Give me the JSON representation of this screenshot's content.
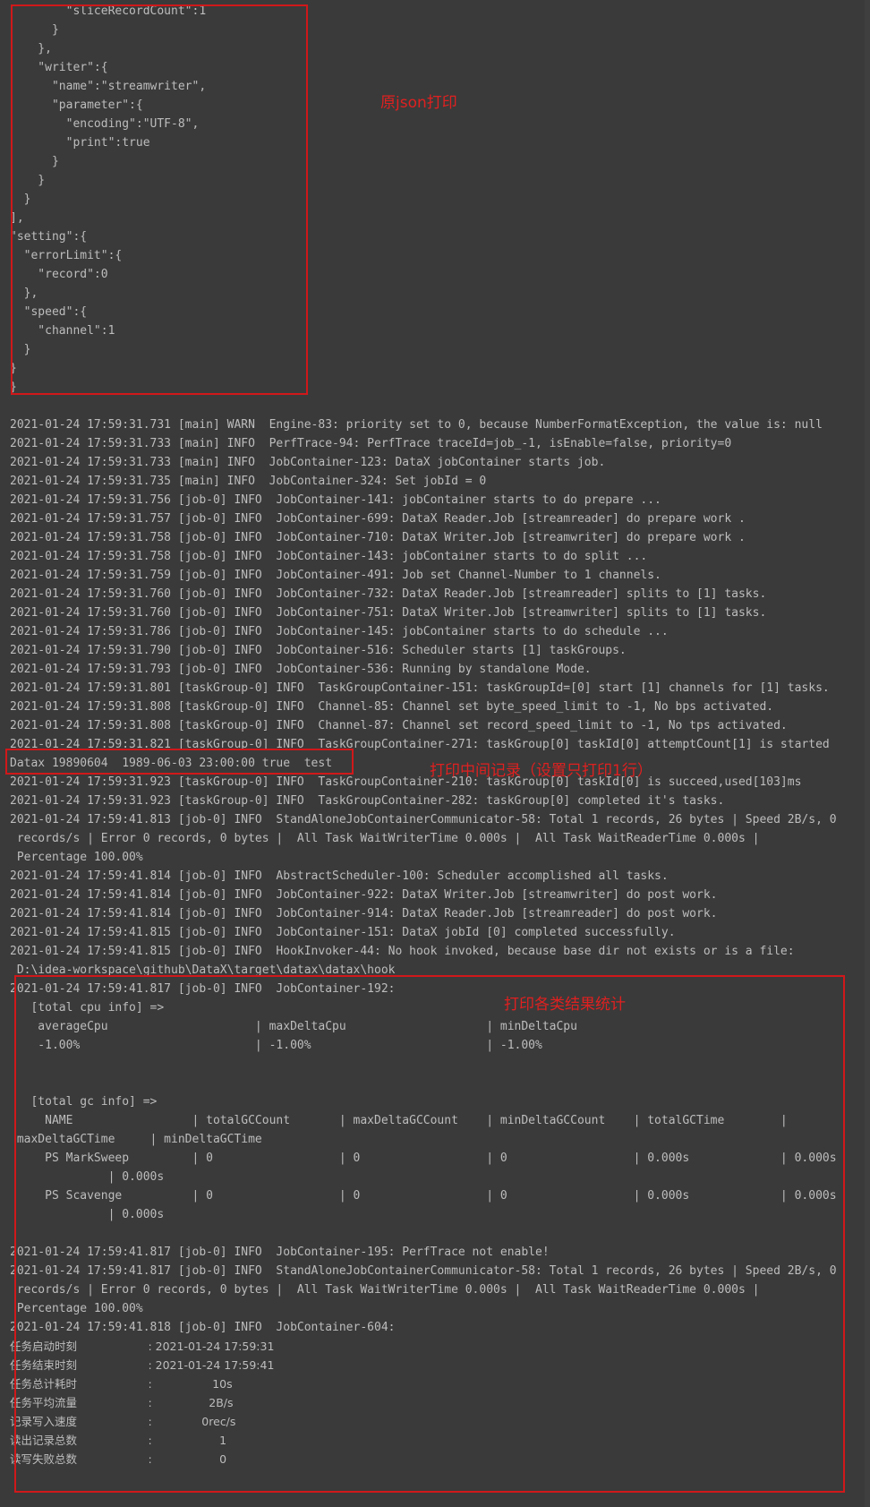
{
  "annotations": {
    "json_note": "原json打印",
    "record_note": "打印中间记录（设置只打印1行）",
    "stats_note": "打印各类结果统计"
  },
  "lines": [
    "        \"sliceRecordCount\":1",
    "      }",
    "    },",
    "    \"writer\":{",
    "      \"name\":\"streamwriter\",",
    "      \"parameter\":{",
    "        \"encoding\":\"UTF-8\",",
    "        \"print\":true",
    "      }",
    "    }",
    "  }",
    "],",
    "\"setting\":{",
    "  \"errorLimit\":{",
    "    \"record\":0",
    "  },",
    "  \"speed\":{",
    "    \"channel\":1",
    "  }",
    "}",
    "}",
    "",
    "2021-01-24 17:59:31.731 [main] WARN  Engine-83: priority set to 0, because NumberFormatException, the value is: null",
    "2021-01-24 17:59:31.733 [main] INFO  PerfTrace-94: PerfTrace traceId=job_-1, isEnable=false, priority=0",
    "2021-01-24 17:59:31.733 [main] INFO  JobContainer-123: DataX jobContainer starts job.",
    "2021-01-24 17:59:31.735 [main] INFO  JobContainer-324: Set jobId = 0",
    "2021-01-24 17:59:31.756 [job-0] INFO  JobContainer-141: jobContainer starts to do prepare ...",
    "2021-01-24 17:59:31.757 [job-0] INFO  JobContainer-699: DataX Reader.Job [streamreader] do prepare work .",
    "2021-01-24 17:59:31.758 [job-0] INFO  JobContainer-710: DataX Writer.Job [streamwriter] do prepare work .",
    "2021-01-24 17:59:31.758 [job-0] INFO  JobContainer-143: jobContainer starts to do split ...",
    "2021-01-24 17:59:31.759 [job-0] INFO  JobContainer-491: Job set Channel-Number to 1 channels.",
    "2021-01-24 17:59:31.760 [job-0] INFO  JobContainer-732: DataX Reader.Job [streamreader] splits to [1] tasks.",
    "2021-01-24 17:59:31.760 [job-0] INFO  JobContainer-751: DataX Writer.Job [streamwriter] splits to [1] tasks.",
    "2021-01-24 17:59:31.786 [job-0] INFO  JobContainer-145: jobContainer starts to do schedule ...",
    "2021-01-24 17:59:31.790 [job-0] INFO  JobContainer-516: Scheduler starts [1] taskGroups.",
    "2021-01-24 17:59:31.793 [job-0] INFO  JobContainer-536: Running by standalone Mode.",
    "2021-01-24 17:59:31.801 [taskGroup-0] INFO  TaskGroupContainer-151: taskGroupId=[0] start [1] channels for [1] tasks.",
    "2021-01-24 17:59:31.808 [taskGroup-0] INFO  Channel-85: Channel set byte_speed_limit to -1, No bps activated.",
    "2021-01-24 17:59:31.808 [taskGroup-0] INFO  Channel-87: Channel set record_speed_limit to -1, No tps activated.",
    "2021-01-24 17:59:31.821 [taskGroup-0] INFO  TaskGroupContainer-271: taskGroup[0] taskId[0] attemptCount[1] is started",
    "Datax 19890604  1989-06-03 23:00:00 true  test",
    "2021-01-24 17:59:31.923 [taskGroup-0] INFO  TaskGroupContainer-210: taskGroup[0] taskId[0] is succeed,used[103]ms",
    "2021-01-24 17:59:31.923 [taskGroup-0] INFO  TaskGroupContainer-282: taskGroup[0] completed it's tasks.",
    "2021-01-24 17:59:41.813 [job-0] INFO  StandAloneJobContainerCommunicator-58: Total 1 records, 26 bytes | Speed 2B/s, 0",
    " records/s | Error 0 records, 0 bytes |  All Task WaitWriterTime 0.000s |  All Task WaitReaderTime 0.000s |",
    " Percentage 100.00%",
    "2021-01-24 17:59:41.814 [job-0] INFO  AbstractScheduler-100: Scheduler accomplished all tasks.",
    "2021-01-24 17:59:41.814 [job-0] INFO  JobContainer-922: DataX Writer.Job [streamwriter] do post work.",
    "2021-01-24 17:59:41.814 [job-0] INFO  JobContainer-914: DataX Reader.Job [streamreader] do post work.",
    "2021-01-24 17:59:41.815 [job-0] INFO  JobContainer-151: DataX jobId [0] completed successfully.",
    "2021-01-24 17:59:41.815 [job-0] INFO  HookInvoker-44: No hook invoked, because base dir not exists or is a file:",
    " D:\\idea-workspace\\github\\DataX\\target\\datax\\datax\\hook",
    "2021-01-24 17:59:41.817 [job-0] INFO  JobContainer-192:",
    "   [total cpu info] =>",
    "    averageCpu                     | maxDeltaCpu                    | minDeltaCpu",
    "    -1.00%                         | -1.00%                         | -1.00%",
    "",
    "",
    "   [total gc info] =>",
    "     NAME                 | totalGCCount       | maxDeltaGCCount    | minDeltaGCCount    | totalGCTime        |",
    " maxDeltaGCTime     | minDeltaGCTime",
    "     PS MarkSweep         | 0                  | 0                  | 0                  | 0.000s             | 0.000s",
    "              | 0.000s",
    "     PS Scavenge          | 0                  | 0                  | 0                  | 0.000s             | 0.000s",
    "              | 0.000s",
    "",
    "2021-01-24 17:59:41.817 [job-0] INFO  JobContainer-195: PerfTrace not enable!",
    "2021-01-24 17:59:41.817 [job-0] INFO  StandAloneJobContainerCommunicator-58: Total 1 records, 26 bytes | Speed 2B/s, 0",
    " records/s | Error 0 records, 0 bytes |  All Task WaitWriterTime 0.000s |  All Task WaitReaderTime 0.000s |",
    " Percentage 100.00%",
    "2021-01-24 17:59:41.818 [job-0] INFO  JobContainer-604:",
    "任务启动时刻                    : 2021-01-24 17:59:31",
    "任务结束时刻                    : 2021-01-24 17:59:41",
    "任务总计耗时                    :                 10s",
    "任务平均流量                    :                2B/s",
    "记录写入速度                    :              0rec/s",
    "读出记录总数                    :                   1",
    "读写失败总数                    :                   0"
  ]
}
